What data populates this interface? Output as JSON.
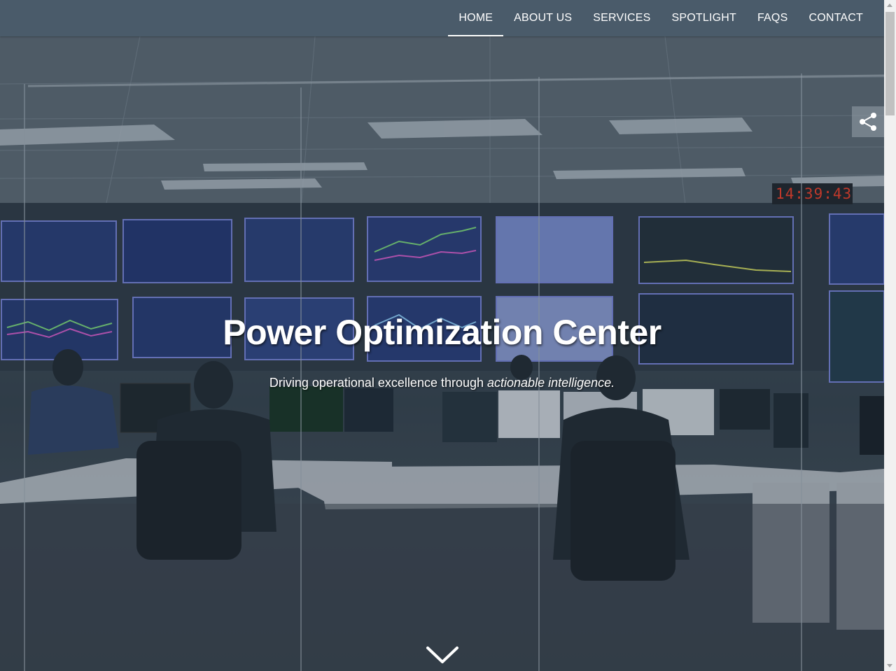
{
  "nav": {
    "items": [
      {
        "label": "HOME",
        "active": true
      },
      {
        "label": "ABOUT US",
        "active": false
      },
      {
        "label": "SERVICES",
        "active": false
      },
      {
        "label": "SPOTLIGHT",
        "active": false
      },
      {
        "label": "FAQS",
        "active": false
      },
      {
        "label": "CONTACT",
        "active": false
      }
    ]
  },
  "hero": {
    "title": "Power Optimization Center",
    "subtitle_prefix": "Driving operational excellence through ",
    "subtitle_emphasis": "actionable intelligence.",
    "clock_text": "14:39:43",
    "background": "control-room-photo",
    "scroll_icon": "chevron-down-icon"
  },
  "share": {
    "icon": "share-icon"
  },
  "colors": {
    "navbar": "#4a5b6a",
    "text": "#ffffff",
    "clock": "#c0392b"
  }
}
